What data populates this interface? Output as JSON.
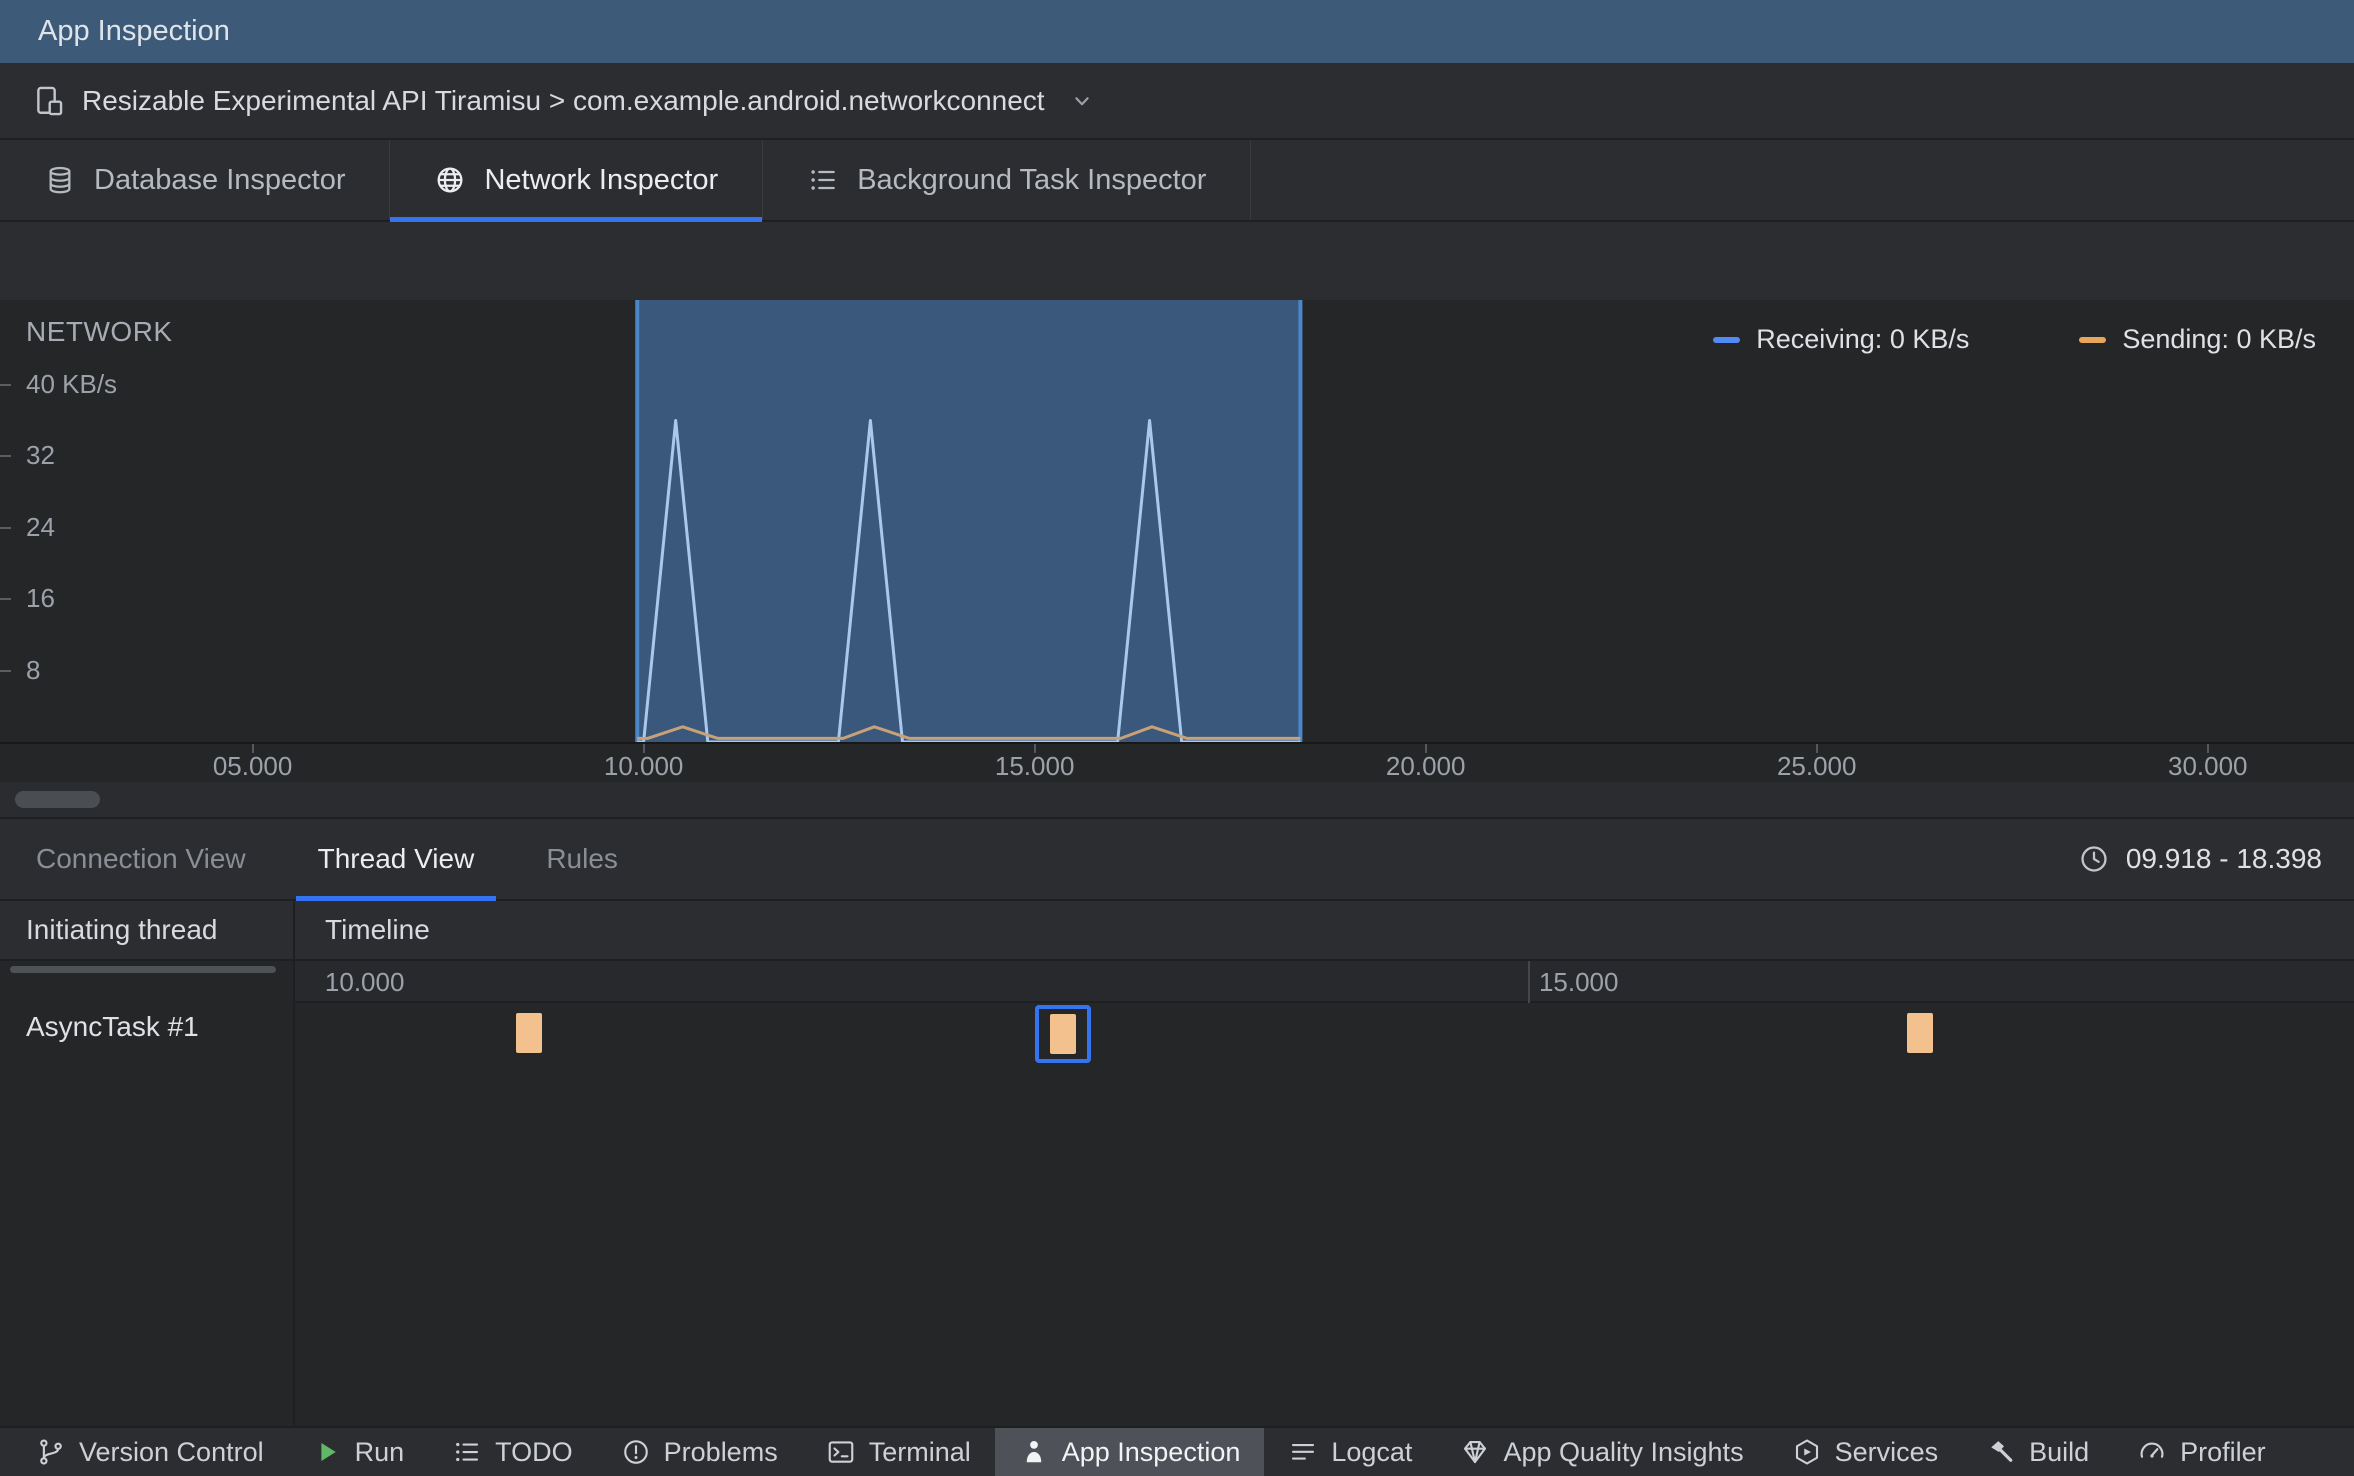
{
  "titlebar": {
    "title": "App Inspection"
  },
  "process_bar": {
    "selection": "Resizable Experimental API Tiramisu > com.example.android.networkconnect"
  },
  "inspector_tabs": {
    "tabs": [
      {
        "id": "database-inspector",
        "label": "Database Inspector",
        "icon": "database-icon",
        "selected": false
      },
      {
        "id": "network-inspector",
        "label": "Network Inspector",
        "icon": "globe-icon",
        "selected": true
      },
      {
        "id": "background-task-inspector",
        "label": "Background Task Inspector",
        "icon": "checklist-icon",
        "selected": false
      }
    ]
  },
  "network_section": {
    "title": "NETWORK",
    "legend": [
      {
        "label": "Receiving: 0 KB/s",
        "color": "#548AF7"
      },
      {
        "label": "Sending: 0 KB/s",
        "color": "#E8A55C"
      }
    ]
  },
  "chart_data": [
    {
      "type": "area",
      "title": "NETWORK",
      "ylabel": "KB/s",
      "xlim": [
        1.77,
        31.87
      ],
      "ylim": [
        0,
        49.5
      ],
      "y_ticks": [
        {
          "value": 40,
          "label": "40 KB/s"
        },
        {
          "value": 32,
          "label": "32"
        },
        {
          "value": 24,
          "label": "24"
        },
        {
          "value": 16,
          "label": "16"
        },
        {
          "value": 8,
          "label": "8"
        }
      ],
      "x_ticks": [
        {
          "value": 5,
          "label": "05.000"
        },
        {
          "value": 10,
          "label": "10.000"
        },
        {
          "value": 15,
          "label": "15.000"
        },
        {
          "value": 20,
          "label": "20.000"
        },
        {
          "value": 25,
          "label": "25.000"
        },
        {
          "value": 30,
          "label": "30.000"
        }
      ],
      "selection": {
        "start": 9.918,
        "end": 18.398
      },
      "series": [
        {
          "name": "Receiving",
          "color": "#A9C9EC",
          "points": [
            [
              9.918,
              0
            ],
            [
              10.0,
              0
            ],
            [
              10.41,
              36
            ],
            [
              10.82,
              0
            ],
            [
              12.49,
              0
            ],
            [
              12.9,
              36
            ],
            [
              13.31,
              0
            ],
            [
              16.06,
              0
            ],
            [
              16.47,
              36
            ],
            [
              16.88,
              0
            ],
            [
              18.398,
              0
            ]
          ]
        },
        {
          "name": "Sending",
          "color": "#C9A179",
          "points": [
            [
              9.918,
              0.4
            ],
            [
              10.05,
              0.4
            ],
            [
              10.5,
              1.7
            ],
            [
              10.95,
              0.4
            ],
            [
              12.55,
              0.4
            ],
            [
              12.95,
              1.7
            ],
            [
              13.4,
              0.4
            ],
            [
              16.1,
              0.4
            ],
            [
              16.5,
              1.7
            ],
            [
              16.95,
              0.4
            ],
            [
              18.398,
              0.4
            ]
          ]
        }
      ]
    },
    {
      "type": "timeline",
      "thread": "AsyncTask #1",
      "xlim": [
        9.918,
        18.398
      ],
      "x_ticks": [
        {
          "value": 10,
          "label": "10.000"
        },
        {
          "value": 15,
          "label": "15.000"
        }
      ],
      "events": [
        {
          "time": 10.88,
          "selected": false
        },
        {
          "time": 13.08,
          "selected": true
        },
        {
          "time": 16.61,
          "selected": false
        }
      ]
    }
  ],
  "view_tabs": {
    "tabs": [
      {
        "label": "Connection View",
        "selected": false
      },
      {
        "label": "Thread View",
        "selected": true
      },
      {
        "label": "Rules",
        "selected": false
      }
    ],
    "range": "09.918 - 18.398"
  },
  "thread_table": {
    "columns": [
      "Initiating thread",
      "Timeline"
    ],
    "rows": [
      {
        "thread": "AsyncTask #1"
      }
    ]
  },
  "bottom_bar": {
    "items": [
      {
        "label": "Version Control",
        "icon": "branch-icon",
        "selected": false
      },
      {
        "label": "Run",
        "icon": "play-icon",
        "selected": false
      },
      {
        "label": "TODO",
        "icon": "todo-icon",
        "selected": false
      },
      {
        "label": "Problems",
        "icon": "problems-icon",
        "selected": false
      },
      {
        "label": "Terminal",
        "icon": "terminal-icon",
        "selected": false
      },
      {
        "label": "App Inspection",
        "icon": "inspector-icon",
        "selected": true
      },
      {
        "label": "Logcat",
        "icon": "logcat-icon",
        "selected": false
      },
      {
        "label": "App Quality Insights",
        "icon": "gem-icon",
        "selected": false
      },
      {
        "label": "Services",
        "icon": "services-icon",
        "selected": false
      },
      {
        "label": "Build",
        "icon": "hammer-icon",
        "selected": false
      },
      {
        "label": "Profiler",
        "icon": "profiler-icon",
        "selected": false
      }
    ]
  },
  "colors": {
    "accent": "#3574F0",
    "titlebar_bg": "#3D5A78",
    "selection_fill": "#3A587B",
    "selection_border": "#4A86C8",
    "event_block": "#F2C18D",
    "run_green": "#5FB865"
  }
}
